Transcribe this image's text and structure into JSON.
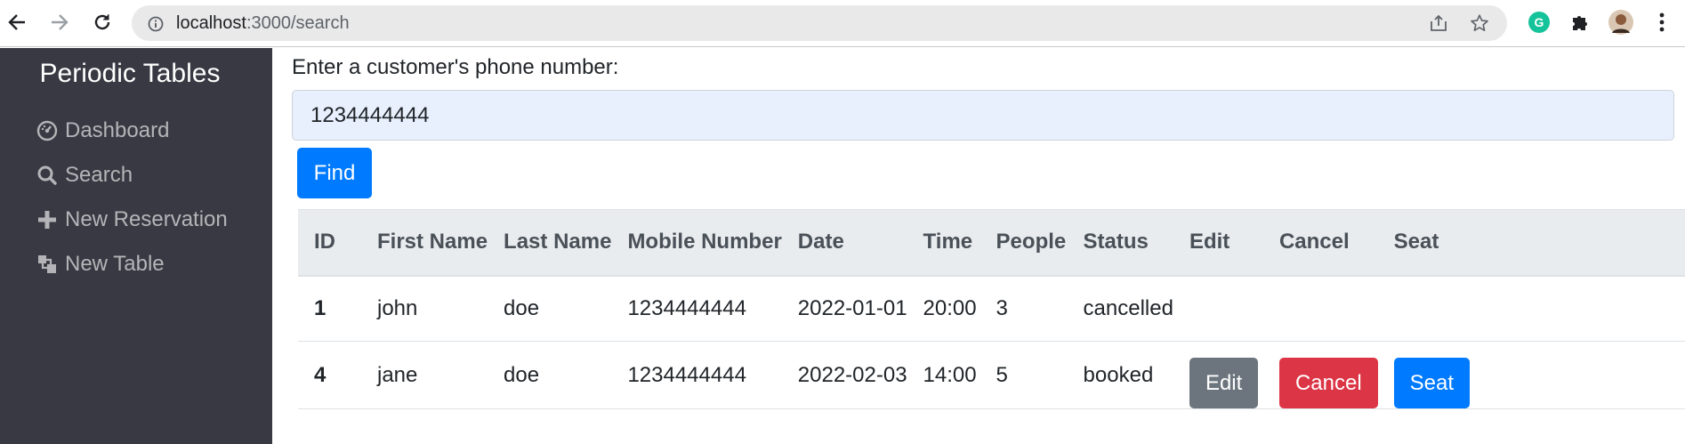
{
  "browser": {
    "url_host": "localhost",
    "url_path": ":3000/search",
    "colors": {
      "accent_green": "#1fb573"
    }
  },
  "sidebar": {
    "brand": "Periodic Tables",
    "items": [
      {
        "label": "Dashboard",
        "icon": "dashboard-icon"
      },
      {
        "label": "Search",
        "icon": "search-icon"
      },
      {
        "label": "New Reservation",
        "icon": "plus-icon"
      },
      {
        "label": "New Table",
        "icon": "layers-icon"
      }
    ]
  },
  "search": {
    "prompt": "Enter a customer's phone number:",
    "value": "1234444444",
    "find_label": "Find"
  },
  "table": {
    "headers": [
      "ID",
      "First Name",
      "Last Name",
      "Mobile Number",
      "Date",
      "Time",
      "People",
      "Status",
      "Edit",
      "Cancel",
      "Seat"
    ],
    "rows": [
      {
        "id": "1",
        "first_name": "john",
        "last_name": "doe",
        "mobile": "1234444444",
        "date": "2022-01-01",
        "time": "20:00",
        "people": "3",
        "status": "cancelled"
      },
      {
        "id": "4",
        "first_name": "jane",
        "last_name": "doe",
        "mobile": "1234444444",
        "date": "2022-02-03",
        "time": "14:00",
        "people": "5",
        "status": "booked",
        "edit_label": "Edit",
        "cancel_label": "Cancel",
        "seat_label": "Seat"
      }
    ]
  }
}
